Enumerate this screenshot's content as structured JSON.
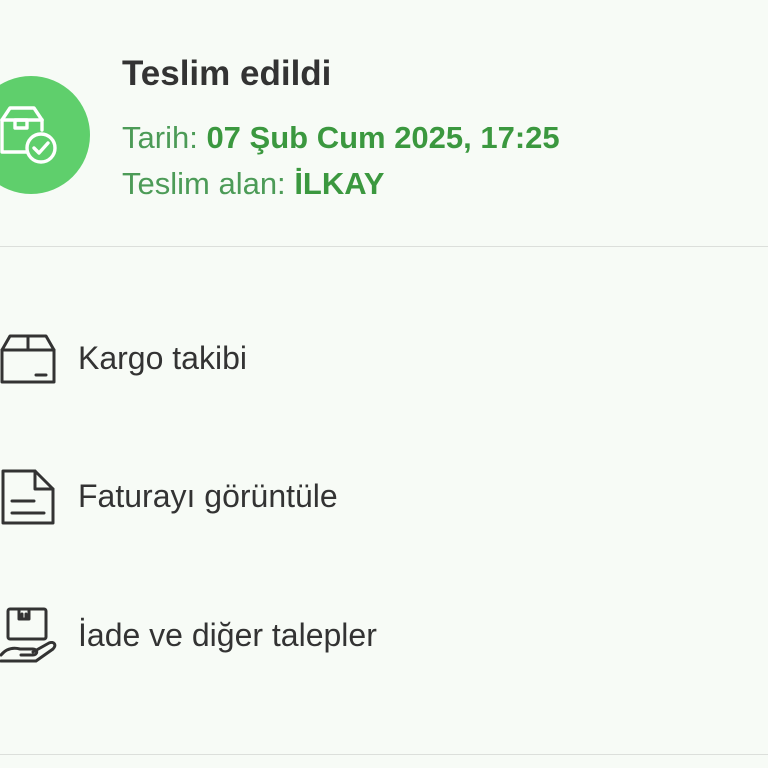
{
  "status": {
    "icon": "package-check-icon",
    "title": "Teslim edildi",
    "date_label": "Tarih:",
    "date_value": "07 Şub Cum 2025, 17:25",
    "receiver_label": "Teslim alan:",
    "receiver_value": "İLKAY",
    "accent_color": "#5fcf6c",
    "text_color": "#3b983f"
  },
  "actions": [
    {
      "icon": "box-icon",
      "label": "Kargo takibi"
    },
    {
      "icon": "invoice-icon",
      "label": "Faturayı görüntüle"
    },
    {
      "icon": "return-hand-icon",
      "label": "İade ve diğer talepler"
    }
  ]
}
